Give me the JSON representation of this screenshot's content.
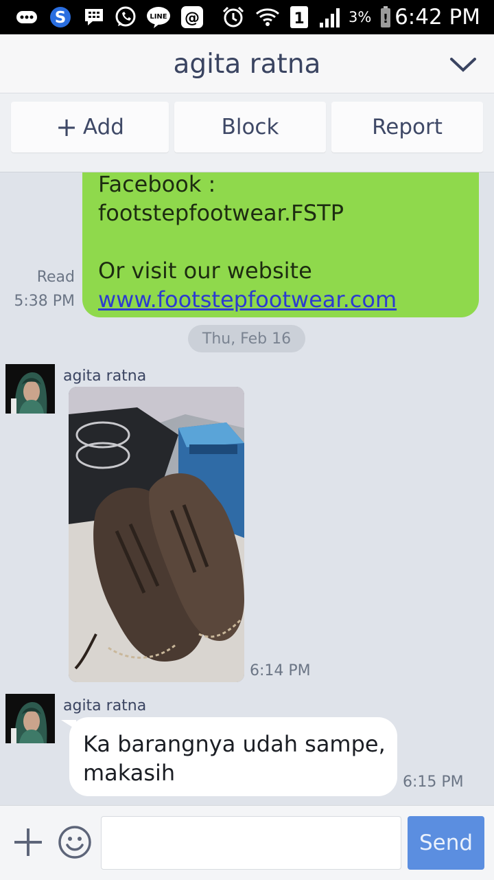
{
  "status_bar": {
    "time": "6:42 PM",
    "battery": "3%",
    "sim_slot": "1",
    "icons": [
      "bbm-icon",
      "skype-icon",
      "blackberry-icon",
      "whatsapp-icon",
      "line-icon",
      "at-icon",
      "alarm-icon",
      "wifi-icon",
      "sim-icon",
      "signal-icon",
      "battery-icon"
    ]
  },
  "header": {
    "title": "agita ratna"
  },
  "actions": {
    "add": "Add",
    "block": "Block",
    "report": "Report"
  },
  "messages": {
    "sent": {
      "line1": "Facebook :",
      "line2": "footstepfootwear.FSTP",
      "line3": "Or visit our website",
      "link": "www.footstepfootwear.com",
      "read": "Read",
      "time": "5:38 PM"
    },
    "date_divider": "Thu, Feb 16",
    "photo_msg": {
      "sender": "agita ratna",
      "time": "6:14 PM"
    },
    "text_msg": {
      "sender": "agita ratna",
      "text": "Ka barangnya udah sampe, makasih",
      "time": "6:15 PM"
    }
  },
  "composer": {
    "placeholder": "",
    "send_label": "Send"
  },
  "colors": {
    "sent_bubble": "#8fd94c",
    "send_button": "#5b8ee0",
    "title": "#3a4461"
  }
}
